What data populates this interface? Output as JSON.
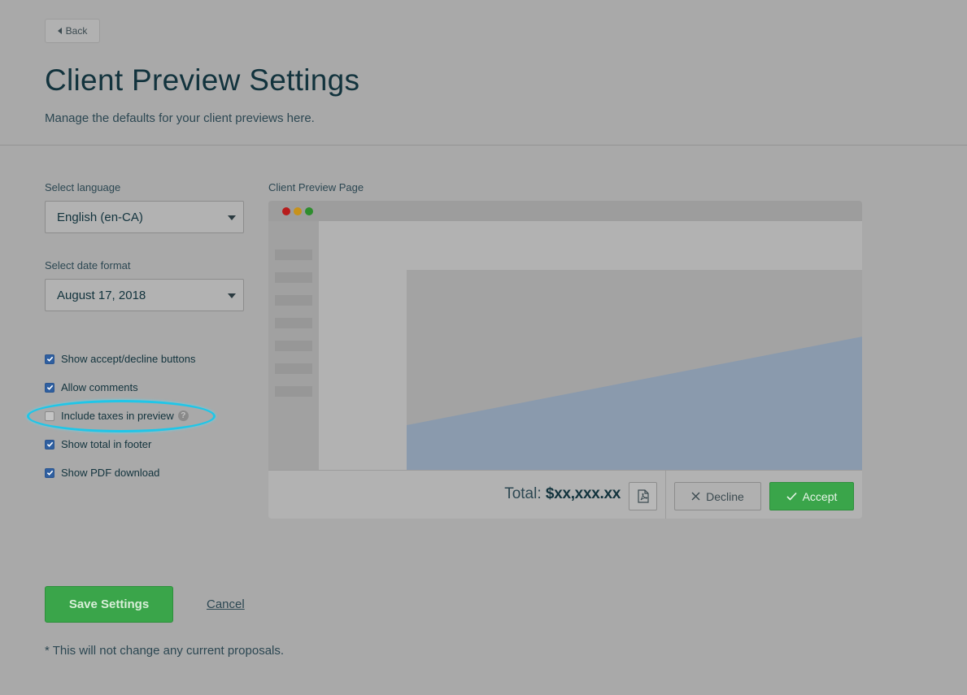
{
  "back_label": "Back",
  "page_title": "Client Preview Settings",
  "subtitle": "Manage the defaults for your client previews here.",
  "language": {
    "label": "Select language",
    "value": "English (en-CA)"
  },
  "date_format": {
    "label": "Select date format",
    "value": "August 17, 2018"
  },
  "options": [
    {
      "label": "Show accept/decline buttons",
      "checked": true
    },
    {
      "label": "Allow comments",
      "checked": true
    },
    {
      "label": "Include taxes in preview",
      "checked": false,
      "help": "?"
    },
    {
      "label": "Show total in footer",
      "checked": true
    },
    {
      "label": "Show PDF download",
      "checked": true
    }
  ],
  "preview": {
    "label": "Client Preview Page",
    "total_prefix": "Total:",
    "total_value": "$xx,xxx.xx",
    "decline_label": "Decline",
    "accept_label": "Accept"
  },
  "save_label": "Save Settings",
  "cancel_label": "Cancel",
  "footnote": "* This will not change any current proposals.",
  "colors": {
    "accent_green": "#3aa54a",
    "highlight": "#1fc6e8",
    "checkbox": "#2f5fa0"
  }
}
